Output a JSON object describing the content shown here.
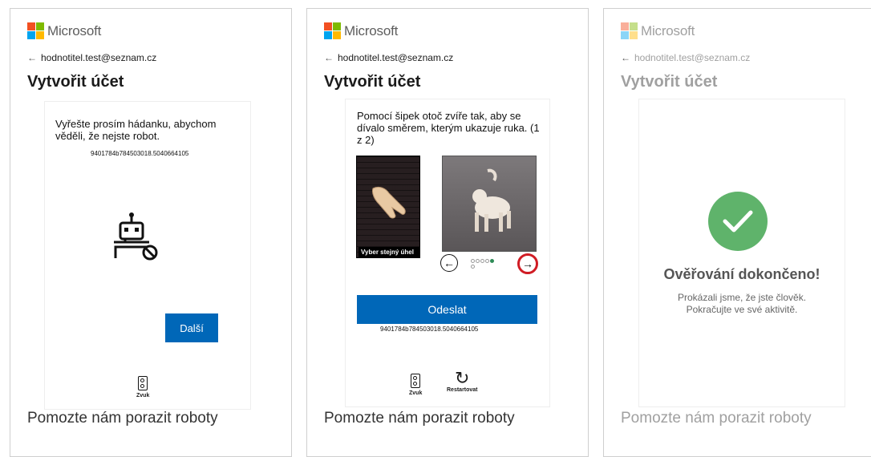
{
  "brand": {
    "name": "Microsoft"
  },
  "account": {
    "email": "hodnotitel.test@seznam.cz"
  },
  "page_title": "Vytvořit účet",
  "footer_text": "Pomozte nám porazit roboty",
  "session_id": "9401784b784503018.5040664105",
  "step1": {
    "prompt": "Vyřešte prosím hádanku, abychom věděli, že nejste robot.",
    "next_button": "Další",
    "sound_label": "Zvuk"
  },
  "step2": {
    "prompt": "Pomocí šipek otoč zvíře tak, aby se dívalo směrem, kterým ukazuje ruka. (1 z 2)",
    "reference_label": "Vyber stejný úhel",
    "submit_button": "Odeslat",
    "sound_label": "Zvuk",
    "restart_label": "Restartovat"
  },
  "step3": {
    "title": "Ověřování dokončeno!",
    "line1": "Prokázali jsme, že jste člověk.",
    "line2": "Pokračujte ve své aktivitě."
  },
  "colors": {
    "primary": "#0067b8",
    "success": "#5fb36b",
    "nav_active": "#d01c24"
  }
}
